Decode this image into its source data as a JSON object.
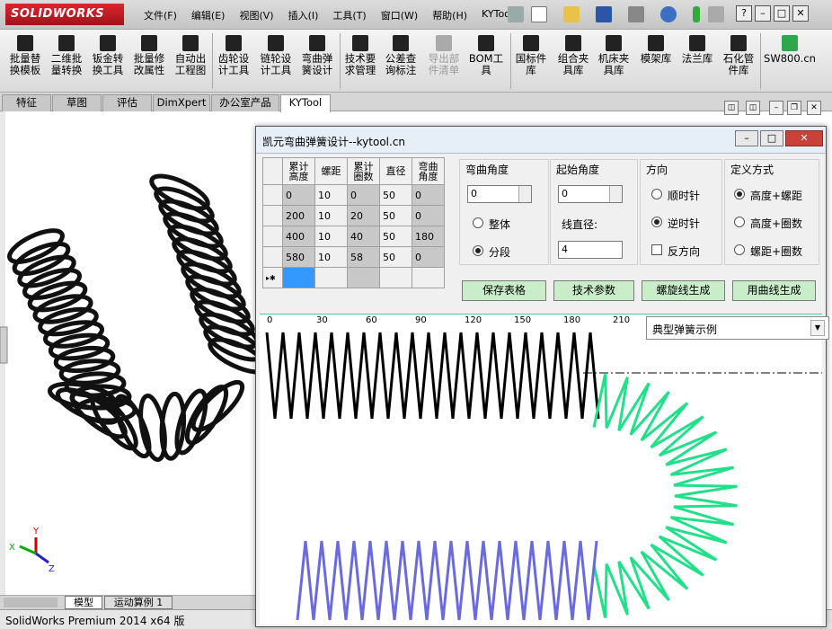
{
  "app": {
    "logo_text": "SOLIDWORKS",
    "menu": [
      "文件(F)",
      "编辑(E)",
      "视图(V)",
      "插入(I)",
      "工具(T)",
      "窗口(W)",
      "帮助(H)",
      "KYTool"
    ],
    "window_buttons": [
      "?",
      "–",
      "□",
      "✕"
    ]
  },
  "commands": [
    {
      "line1": "批量替",
      "line2": "换模板"
    },
    {
      "line1": "二维批",
      "line2": "量转换"
    },
    {
      "line1": "钣金转",
      "line2": "换工具"
    },
    {
      "line1": "批量修",
      "line2": "改属性"
    },
    {
      "line1": "自动出",
      "line2": "工程图"
    },
    {
      "line1": "齿轮设",
      "line2": "计工具"
    },
    {
      "line1": "链轮设",
      "line2": "计工具"
    },
    {
      "line1": "弯曲弹",
      "line2": "簧设计"
    },
    {
      "line1": "技术要",
      "line2": "求管理"
    },
    {
      "line1": "公差查",
      "line2": "询标注"
    },
    {
      "line1": "导出部",
      "line2": "件清单",
      "disabled": true
    },
    {
      "line1": "BOM工",
      "line2": "具"
    },
    {
      "line1": "国标件",
      "line2": "库"
    },
    {
      "line1": "组合夹",
      "line2": "具库"
    },
    {
      "line1": "机床夹",
      "line2": "具库"
    },
    {
      "line1": "模架库",
      "line2": ""
    },
    {
      "line1": "法兰库",
      "line2": ""
    },
    {
      "line1": "石化管",
      "line2": "件库"
    },
    {
      "line1": "SW800.cn",
      "line2": ""
    }
  ],
  "feature_tabs": [
    "特征",
    "草图",
    "评估",
    "DimXpert",
    "办公室产品",
    "KYTool"
  ],
  "active_feature_tab": "KYTool",
  "bottom_tabs": [
    "模型",
    "运动算例 1"
  ],
  "status_bar": "SolidWorks Premium 2014 x64 版",
  "dialog": {
    "title": "凯元弯曲弹簧设计--kytool.cn",
    "table": {
      "headers": [
        "累计\n高度",
        "螺距",
        "累计\n圈数",
        "直径",
        "弯曲\n角度"
      ],
      "rows": [
        [
          "0",
          "10",
          "0",
          "50",
          "0"
        ],
        [
          "200",
          "10",
          "20",
          "50",
          "0"
        ],
        [
          "400",
          "10",
          "40",
          "50",
          "180"
        ],
        [
          "580",
          "10",
          "58",
          "50",
          "0"
        ]
      ],
      "new_row_marker": "▸✱"
    },
    "bend_angle": {
      "label": "弯曲角度",
      "value": "0",
      "options": [
        "整体",
        "分段"
      ],
      "selected": "分段"
    },
    "start_angle": {
      "label": "起始角度",
      "value": "0",
      "wire_label": "线直径:",
      "wire_value": "4"
    },
    "direction": {
      "label": "方向",
      "options": [
        "顺时针",
        "逆时针"
      ],
      "selected": "逆时针",
      "reverse_label": "反方向",
      "reverse_checked": false
    },
    "define_mode": {
      "label": "定义方式",
      "options": [
        "高度+螺距",
        "高度+圈数",
        "螺距+圈数"
      ],
      "selected": "高度+螺距"
    },
    "buttons": [
      "保存表格",
      "技术参数",
      "螺旋线生成",
      "用曲线生成"
    ],
    "ruler_ticks": [
      "0",
      "30",
      "60",
      "90",
      "120",
      "150",
      "180",
      "210"
    ],
    "example_dropdown": "典型弹簧示例",
    "colors": {
      "segment1": "#000000",
      "segment_bend": "#22e08a",
      "segment3": "#6a6ae0"
    }
  },
  "triad_labels": [
    "Y",
    "X",
    "Z"
  ]
}
